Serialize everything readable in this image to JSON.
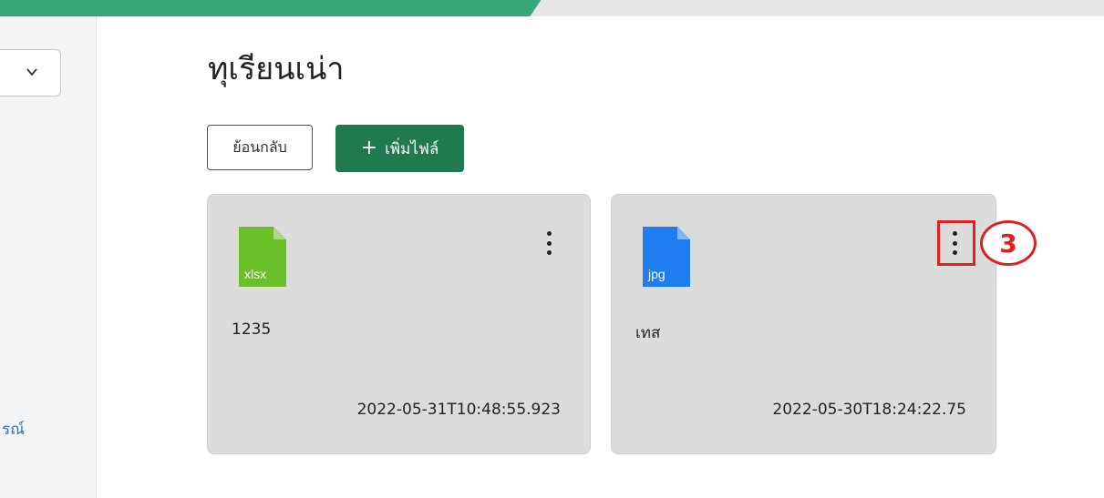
{
  "header": {
    "progress_percent": 49
  },
  "sidebar": {
    "dropdown_icon": "chevron-down-icon",
    "partial_link_text": "รณ์"
  },
  "page": {
    "title": "ทุเรียนเน่า"
  },
  "toolbar": {
    "back_label": "ย้อนกลับ",
    "add_icon": "+",
    "add_label": "เพิ่มไฟล์"
  },
  "files": [
    {
      "type_label": "xlsx",
      "icon_color": "#6bbf2a",
      "name": "1235",
      "date": "2022-05-31T10:48:55.923"
    },
    {
      "type_label": "jpg",
      "icon_color": "#1e7ef0",
      "name": "เทส",
      "date": "2022-05-30T18:24:22.75"
    }
  ],
  "annotation": {
    "step_number": "3",
    "color": "#e02020"
  }
}
